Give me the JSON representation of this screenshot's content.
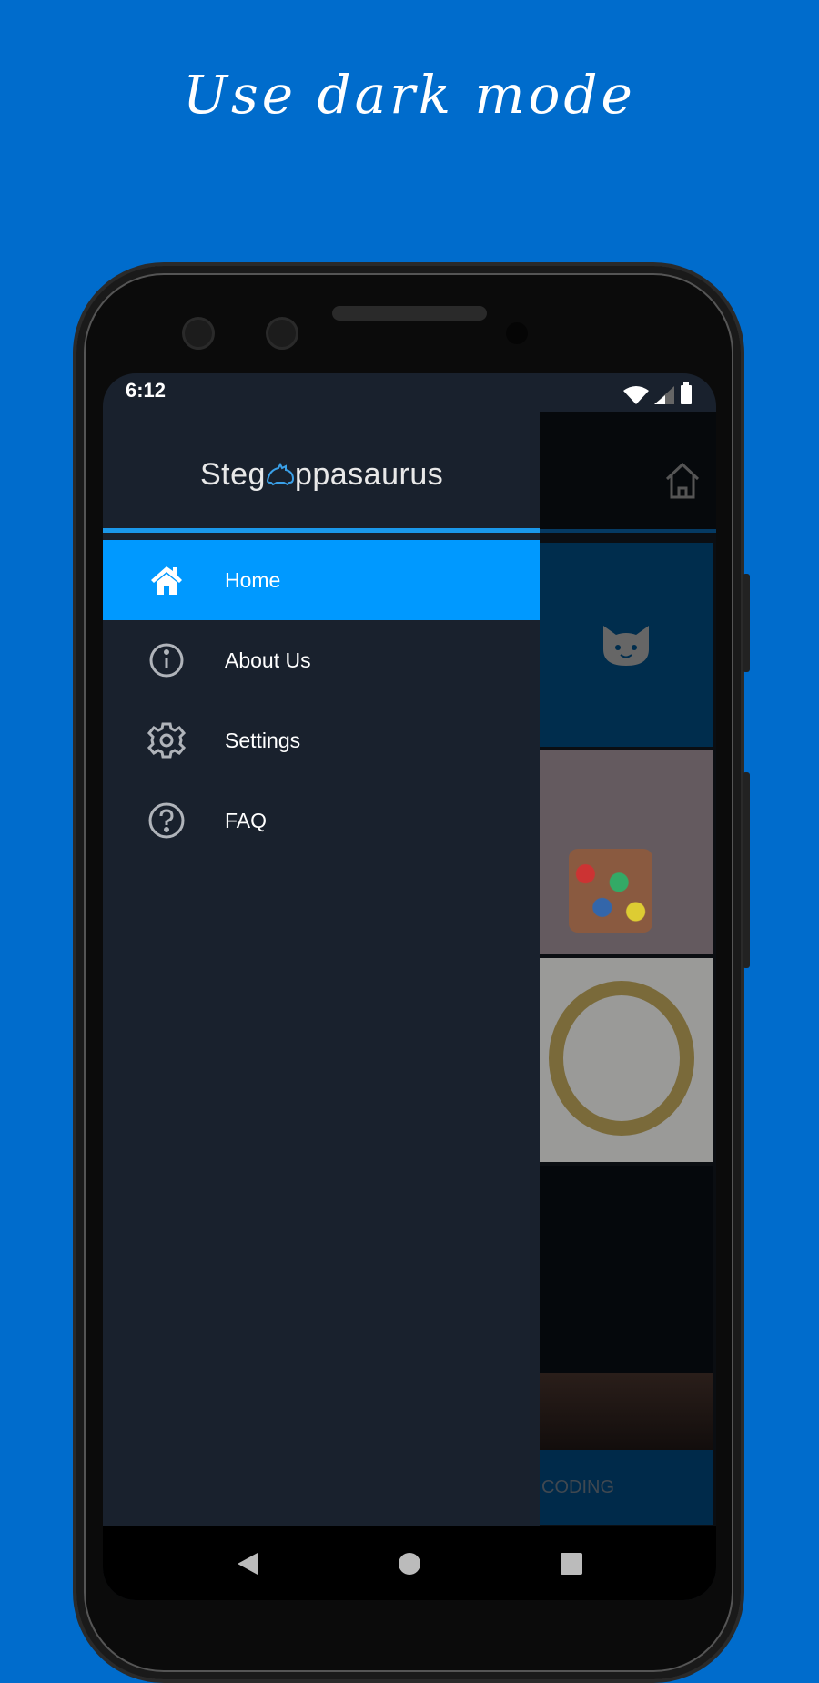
{
  "headline": "Use dark mode",
  "status_bar": {
    "time": "6:12",
    "icons": [
      "wifi-icon",
      "signal-icon",
      "battery-icon"
    ]
  },
  "drawer": {
    "logo_text_left": "Steg",
    "logo_text_right": "ppasaurus",
    "items": [
      {
        "label": "Home",
        "icon": "home-icon",
        "active": true
      },
      {
        "label": "About Us",
        "icon": "info-icon",
        "active": false
      },
      {
        "label": "Settings",
        "icon": "gear-icon",
        "active": false
      },
      {
        "label": "FAQ",
        "icon": "help-icon",
        "active": false
      }
    ]
  },
  "content": {
    "toolbar_icon": "home-outline-icon",
    "tiles": [
      {
        "icon": "cat-icon"
      },
      {
        "image": "candies"
      },
      {
        "image": "leaf-wreath"
      },
      {
        "image": "night-sky"
      },
      {
        "image": "storm-clouds"
      },
      {
        "label": "CODING"
      }
    ]
  },
  "colors": {
    "background": "#006ccc",
    "drawer": "#19212d",
    "accent": "#0099ff"
  }
}
